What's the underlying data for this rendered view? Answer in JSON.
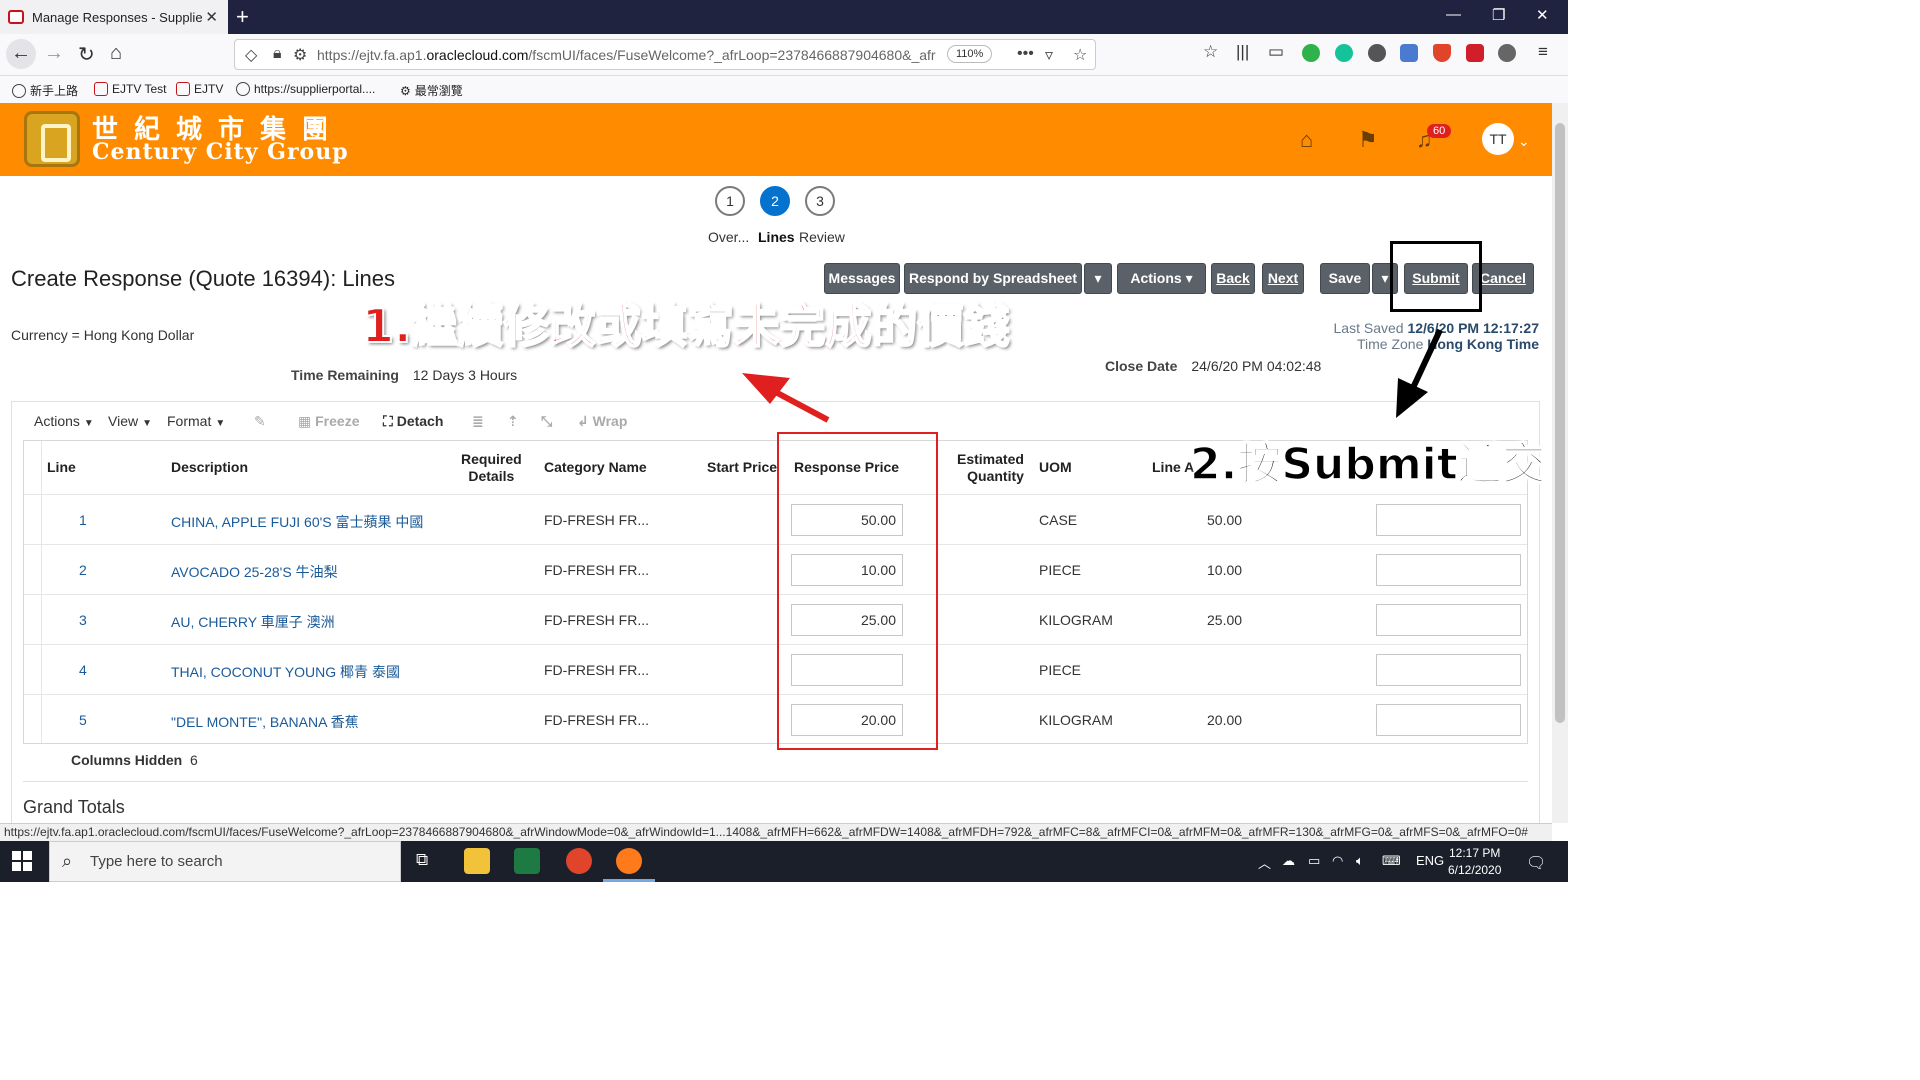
{
  "browser": {
    "tab_title": "Manage Responses - Supplier P",
    "url_prefix": "https://ejtv.fa.ap1.",
    "url_domain": "oraclecloud.com",
    "url_rest": "/fscmUI/faces/FuseWelcome?_afrLoop=2378466887904680&_afr",
    "zoom": "110%",
    "bookmarks": [
      "新手上路",
      "EJTV Test",
      "EJTV",
      "https://supplierportal....",
      "最常瀏覽"
    ]
  },
  "brand": {
    "name_cn": "世紀城市集團",
    "name_en": "Century City Group",
    "notification_count": "60",
    "avatar_initials": "TT"
  },
  "train": {
    "stops": [
      {
        "number": "1",
        "label": "Over..."
      },
      {
        "number": "2",
        "label": "Lines"
      },
      {
        "number": "3",
        "label": "Review"
      }
    ]
  },
  "page": {
    "title": "Create Response (Quote 16394): Lines",
    "currency": "Currency = Hong Kong Dollar",
    "last_saved_label": "Last Saved",
    "last_saved_value": "12/6/20 PM 12:17:27",
    "time_zone_label": "Time Zone",
    "time_zone_value": "Hong Kong Time",
    "time_remaining_label": "Time Remaining",
    "time_remaining_value": "12 Days 3 Hours",
    "close_date_label": "Close Date",
    "close_date_value": "24/6/20 PM 04:02:48"
  },
  "buttons": {
    "messages": "Messages",
    "respond_by_spreadsheet": "Respond by Spreadsheet",
    "actions": "Actions",
    "back": "Back",
    "next": "Next",
    "save": "Save",
    "submit": "Submit",
    "cancel": "Cancel"
  },
  "table_toolbar": {
    "actions": "Actions",
    "view": "View",
    "format": "Format",
    "freeze": "Freeze",
    "detach": "Detach",
    "wrap": "Wrap"
  },
  "table": {
    "headers": {
      "line": "Line",
      "description": "Description",
      "required_details_1": "Required",
      "required_details_2": "Details",
      "category_name": "Category Name",
      "start_price": "Start Price",
      "response_price": "Response Price",
      "estimated_quantity_1": "Estimated",
      "estimated_quantity_2": "Quantity",
      "uom": "UOM",
      "line_amount": "Line A"
    },
    "rows": [
      {
        "line": "1",
        "description": "CHINA, APPLE FUJI 60'S 富士蘋果 中國",
        "category": "FD-FRESH FR...",
        "response_price": "50.00",
        "uom": "CASE",
        "line_amount": "50.00"
      },
      {
        "line": "2",
        "description": "AVOCADO 25-28'S 牛油梨",
        "category": "FD-FRESH FR...",
        "response_price": "10.00",
        "uom": "PIECE",
        "line_amount": "10.00"
      },
      {
        "line": "3",
        "description": "AU, CHERRY 車厘子 澳洲",
        "category": "FD-FRESH FR...",
        "response_price": "25.00",
        "uom": "KILOGRAM",
        "line_amount": "25.00"
      },
      {
        "line": "4",
        "description": "THAI, COCONUT YOUNG 椰青 泰國",
        "category": "FD-FRESH FR...",
        "response_price": "",
        "uom": "PIECE",
        "line_amount": ""
      },
      {
        "line": "5",
        "description": "\"DEL MONTE\", BANANA 香蕉",
        "category": "FD-FRESH FR...",
        "response_price": "20.00",
        "uom": "KILOGRAM",
        "line_amount": "20.00"
      }
    ],
    "columns_hidden_label": "Columns Hidden",
    "columns_hidden_value": "6",
    "grand_totals": "Grand Totals"
  },
  "annotations": {
    "step1": "1.繼續修改或填寫未完成的價錢",
    "step2": "2.按Submit遞交"
  },
  "status_bar": "https://ejtv.fa.ap1.oraclecloud.com/fscmUI/faces/FuseWelcome?_afrLoop=2378466887904680&_afrWindowMode=0&_afrWindowId=1...1408&_afrMFH=662&_afrMFDW=1408&_afrMFDH=792&_afrMFC=8&_afrMFCI=0&_afrMFM=0&_afrMFR=130&_afrMFG=0&_afrMFS=0&_afrMFO=0#",
  "taskbar": {
    "search_placeholder": "Type here to search",
    "language": "ENG",
    "time": "12:17 PM",
    "date": "6/12/2020"
  },
  "colors": {
    "brand_orange": "#ff8c00",
    "button_gray": "#5a6168",
    "train_active": "#0572ce",
    "annotation_red": "#e0201f"
  }
}
